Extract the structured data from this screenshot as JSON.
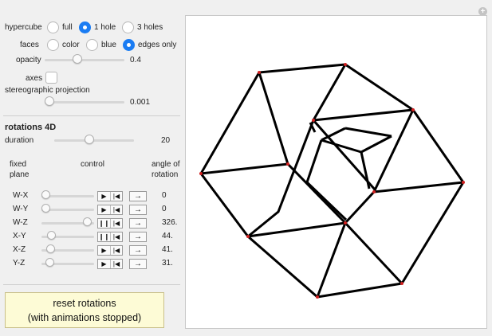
{
  "hypercube": {
    "label": "hypercube",
    "options": [
      "full",
      "1 hole",
      "3 holes"
    ],
    "selected": "1 hole"
  },
  "faces": {
    "label": "faces",
    "options": [
      "color",
      "blue",
      "edges only"
    ],
    "selected": "edges only"
  },
  "opacity": {
    "label": "opacity",
    "value": "0.4",
    "fraction": 0.4
  },
  "axes": {
    "label": "axes",
    "checked": false
  },
  "stereo": {
    "label": "stereographic projection",
    "value": "0.001",
    "fraction": 0.0
  },
  "rotations": {
    "heading": "rotations 4D",
    "duration": {
      "label": "duration",
      "value": "20"
    },
    "col_fixed": [
      "fixed",
      "plane"
    ],
    "col_control": "control",
    "col_angle": [
      "angle of",
      "rotation"
    ],
    "rows": [
      {
        "plane": "W-X",
        "state": "paused",
        "angle": "0"
      },
      {
        "plane": "W-Y",
        "state": "paused",
        "angle": "0"
      },
      {
        "plane": "W-Z",
        "state": "playing",
        "angle": "326."
      },
      {
        "plane": "X-Y",
        "state": "playing",
        "angle": "44."
      },
      {
        "plane": "X-Z",
        "state": "paused",
        "angle": "41."
      },
      {
        "plane": "Y-Z",
        "state": "paused",
        "angle": "31."
      }
    ],
    "play_glyph": "▶",
    "pause_glyph": "❙❙",
    "reset_glyph": "|◀",
    "step_glyph": "→"
  },
  "reset_button": {
    "line1": "reset rotations",
    "line2": "(with animations stopped)"
  },
  "plus_glyph": "+",
  "colors": {
    "accent": "#1a7cf3",
    "reset_bg": "#fdfbd6",
    "edge": "#000000",
    "vertex": "#d02020"
  }
}
